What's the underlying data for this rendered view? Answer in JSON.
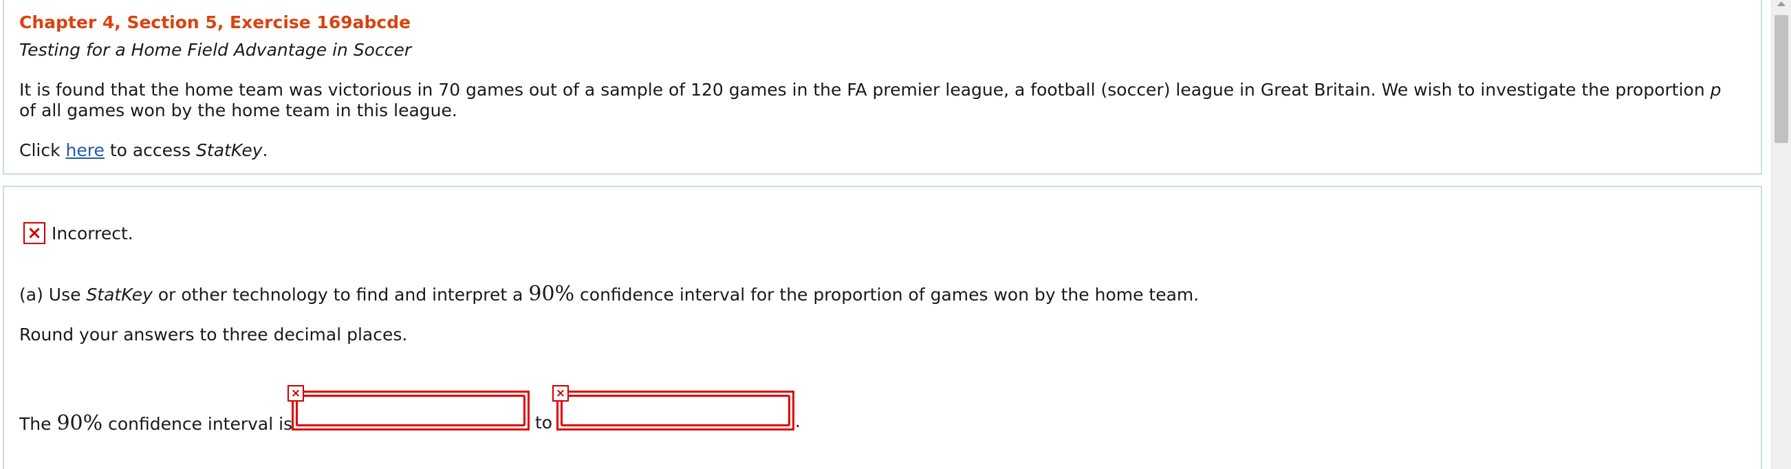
{
  "header": {
    "title": "Chapter 4, Section 5, Exercise 169abcde",
    "subtitle": "Testing for a Home Field Advantage in Soccer"
  },
  "problem": {
    "text_before_p": "It is found that the home team was victorious in 70 games out of a sample of 120 games in the FA premier league, a football (soccer) league in Great Britain. We wish to investigate the proportion ",
    "variable": "p",
    "text_after_p": " of all games won by the home team in this league.",
    "access_prefix": "Click ",
    "access_link": "here",
    "access_middle": " to access ",
    "access_tool": "StatKey",
    "access_suffix": "."
  },
  "result": {
    "status": "Incorrect.",
    "status_color": "#cc0000"
  },
  "part_a": {
    "prefix": "(a) Use ",
    "tool": "StatKey",
    "middle": " or other technology to find and interpret a ",
    "percent": "90%",
    "suffix": " confidence interval for the proportion of games won by the home team.",
    "round_note": "Round your answers to three decimal places.",
    "ci_prefix": "The ",
    "ci_percent": "90%",
    "ci_suffix": " confidence interval is:",
    "to_label": "to",
    "period": ".",
    "lower_value": "",
    "upper_value": ""
  },
  "colors": {
    "title": "#d84311",
    "link": "#1f5aa8",
    "panel_border": "#c9dbe8",
    "error_border": "#e00000"
  }
}
